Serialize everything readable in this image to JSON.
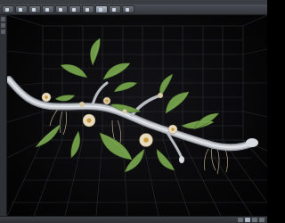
{
  "window": {
    "title": ""
  },
  "tabs": [
    {
      "label": "",
      "active": false
    },
    {
      "label": "",
      "active": false
    },
    {
      "label": "",
      "active": false
    },
    {
      "label": "",
      "active": false
    },
    {
      "label": "",
      "active": false
    },
    {
      "label": "",
      "active": false
    },
    {
      "label": "",
      "active": false
    },
    {
      "label": "",
      "active": true
    },
    {
      "label": "",
      "active": false
    },
    {
      "label": "",
      "active": false
    }
  ],
  "viewport": {
    "label": ""
  },
  "colors": {
    "background": "#060607",
    "grid": "#2c2f33",
    "leaf": "#6f9a48",
    "stem": "#c8ccd2",
    "flower": "#e8dcc0",
    "root": "#b8a88a"
  }
}
